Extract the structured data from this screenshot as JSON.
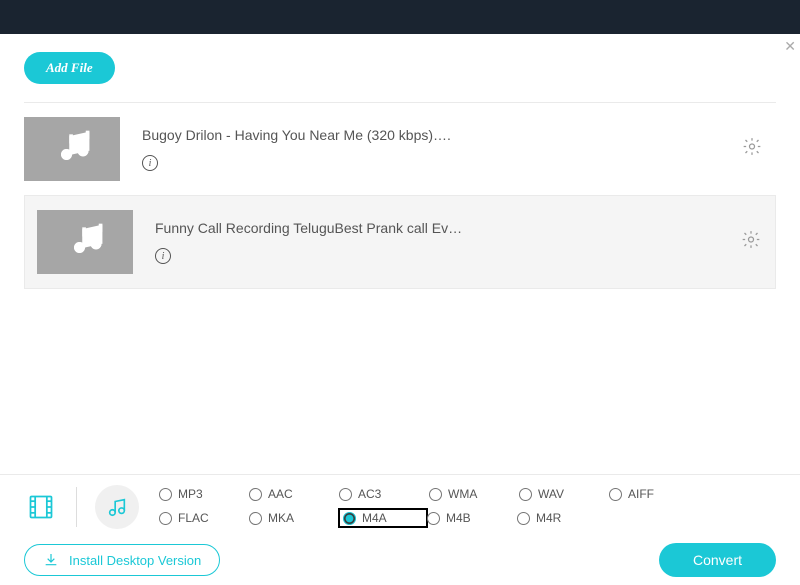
{
  "buttons": {
    "add_file": "Add File",
    "install": "Install Desktop Version",
    "convert": "Convert"
  },
  "files": [
    {
      "title": "Bugoy Drilon - Having You Near Me (320 kbps)….",
      "selected": false
    },
    {
      "title": "Funny Call Recording TeluguBest Prank call Ev…",
      "selected": true
    }
  ],
  "formats": {
    "row1": [
      "MP3",
      "AAC",
      "AC3",
      "WMA",
      "WAV",
      "AIFF",
      "FLAC"
    ],
    "row2": [
      "MKA",
      "M4A",
      "M4B",
      "M4R"
    ],
    "selected": "M4A",
    "highlighted": "M4A"
  }
}
